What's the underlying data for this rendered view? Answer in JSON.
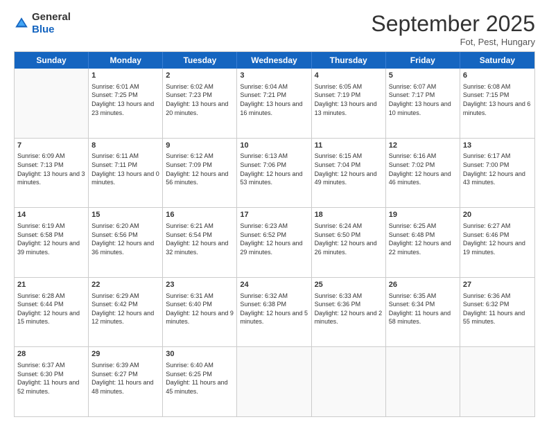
{
  "logo": {
    "general": "General",
    "blue": "Blue"
  },
  "header": {
    "month_title": "September 2025",
    "subtitle": "Fot, Pest, Hungary"
  },
  "days_of_week": [
    "Sunday",
    "Monday",
    "Tuesday",
    "Wednesday",
    "Thursday",
    "Friday",
    "Saturday"
  ],
  "weeks": [
    [
      {
        "day": "",
        "empty": true
      },
      {
        "day": "1",
        "sunrise": "Sunrise: 6:01 AM",
        "sunset": "Sunset: 7:25 PM",
        "daylight": "Daylight: 13 hours and 23 minutes."
      },
      {
        "day": "2",
        "sunrise": "Sunrise: 6:02 AM",
        "sunset": "Sunset: 7:23 PM",
        "daylight": "Daylight: 13 hours and 20 minutes."
      },
      {
        "day": "3",
        "sunrise": "Sunrise: 6:04 AM",
        "sunset": "Sunset: 7:21 PM",
        "daylight": "Daylight: 13 hours and 16 minutes."
      },
      {
        "day": "4",
        "sunrise": "Sunrise: 6:05 AM",
        "sunset": "Sunset: 7:19 PM",
        "daylight": "Daylight: 13 hours and 13 minutes."
      },
      {
        "day": "5",
        "sunrise": "Sunrise: 6:07 AM",
        "sunset": "Sunset: 7:17 PM",
        "daylight": "Daylight: 13 hours and 10 minutes."
      },
      {
        "day": "6",
        "sunrise": "Sunrise: 6:08 AM",
        "sunset": "Sunset: 7:15 PM",
        "daylight": "Daylight: 13 hours and 6 minutes."
      }
    ],
    [
      {
        "day": "7",
        "sunrise": "Sunrise: 6:09 AM",
        "sunset": "Sunset: 7:13 PM",
        "daylight": "Daylight: 13 hours and 3 minutes."
      },
      {
        "day": "8",
        "sunrise": "Sunrise: 6:11 AM",
        "sunset": "Sunset: 7:11 PM",
        "daylight": "Daylight: 13 hours and 0 minutes."
      },
      {
        "day": "9",
        "sunrise": "Sunrise: 6:12 AM",
        "sunset": "Sunset: 7:09 PM",
        "daylight": "Daylight: 12 hours and 56 minutes."
      },
      {
        "day": "10",
        "sunrise": "Sunrise: 6:13 AM",
        "sunset": "Sunset: 7:06 PM",
        "daylight": "Daylight: 12 hours and 53 minutes."
      },
      {
        "day": "11",
        "sunrise": "Sunrise: 6:15 AM",
        "sunset": "Sunset: 7:04 PM",
        "daylight": "Daylight: 12 hours and 49 minutes."
      },
      {
        "day": "12",
        "sunrise": "Sunrise: 6:16 AM",
        "sunset": "Sunset: 7:02 PM",
        "daylight": "Daylight: 12 hours and 46 minutes."
      },
      {
        "day": "13",
        "sunrise": "Sunrise: 6:17 AM",
        "sunset": "Sunset: 7:00 PM",
        "daylight": "Daylight: 12 hours and 43 minutes."
      }
    ],
    [
      {
        "day": "14",
        "sunrise": "Sunrise: 6:19 AM",
        "sunset": "Sunset: 6:58 PM",
        "daylight": "Daylight: 12 hours and 39 minutes."
      },
      {
        "day": "15",
        "sunrise": "Sunrise: 6:20 AM",
        "sunset": "Sunset: 6:56 PM",
        "daylight": "Daylight: 12 hours and 36 minutes."
      },
      {
        "day": "16",
        "sunrise": "Sunrise: 6:21 AM",
        "sunset": "Sunset: 6:54 PM",
        "daylight": "Daylight: 12 hours and 32 minutes."
      },
      {
        "day": "17",
        "sunrise": "Sunrise: 6:23 AM",
        "sunset": "Sunset: 6:52 PM",
        "daylight": "Daylight: 12 hours and 29 minutes."
      },
      {
        "day": "18",
        "sunrise": "Sunrise: 6:24 AM",
        "sunset": "Sunset: 6:50 PM",
        "daylight": "Daylight: 12 hours and 26 minutes."
      },
      {
        "day": "19",
        "sunrise": "Sunrise: 6:25 AM",
        "sunset": "Sunset: 6:48 PM",
        "daylight": "Daylight: 12 hours and 22 minutes."
      },
      {
        "day": "20",
        "sunrise": "Sunrise: 6:27 AM",
        "sunset": "Sunset: 6:46 PM",
        "daylight": "Daylight: 12 hours and 19 minutes."
      }
    ],
    [
      {
        "day": "21",
        "sunrise": "Sunrise: 6:28 AM",
        "sunset": "Sunset: 6:44 PM",
        "daylight": "Daylight: 12 hours and 15 minutes."
      },
      {
        "day": "22",
        "sunrise": "Sunrise: 6:29 AM",
        "sunset": "Sunset: 6:42 PM",
        "daylight": "Daylight: 12 hours and 12 minutes."
      },
      {
        "day": "23",
        "sunrise": "Sunrise: 6:31 AM",
        "sunset": "Sunset: 6:40 PM",
        "daylight": "Daylight: 12 hours and 9 minutes."
      },
      {
        "day": "24",
        "sunrise": "Sunrise: 6:32 AM",
        "sunset": "Sunset: 6:38 PM",
        "daylight": "Daylight: 12 hours and 5 minutes."
      },
      {
        "day": "25",
        "sunrise": "Sunrise: 6:33 AM",
        "sunset": "Sunset: 6:36 PM",
        "daylight": "Daylight: 12 hours and 2 minutes."
      },
      {
        "day": "26",
        "sunrise": "Sunrise: 6:35 AM",
        "sunset": "Sunset: 6:34 PM",
        "daylight": "Daylight: 11 hours and 58 minutes."
      },
      {
        "day": "27",
        "sunrise": "Sunrise: 6:36 AM",
        "sunset": "Sunset: 6:32 PM",
        "daylight": "Daylight: 11 hours and 55 minutes."
      }
    ],
    [
      {
        "day": "28",
        "sunrise": "Sunrise: 6:37 AM",
        "sunset": "Sunset: 6:30 PM",
        "daylight": "Daylight: 11 hours and 52 minutes."
      },
      {
        "day": "29",
        "sunrise": "Sunrise: 6:39 AM",
        "sunset": "Sunset: 6:27 PM",
        "daylight": "Daylight: 11 hours and 48 minutes."
      },
      {
        "day": "30",
        "sunrise": "Sunrise: 6:40 AM",
        "sunset": "Sunset: 6:25 PM",
        "daylight": "Daylight: 11 hours and 45 minutes."
      },
      {
        "day": "",
        "empty": true
      },
      {
        "day": "",
        "empty": true
      },
      {
        "day": "",
        "empty": true
      },
      {
        "day": "",
        "empty": true
      }
    ]
  ]
}
